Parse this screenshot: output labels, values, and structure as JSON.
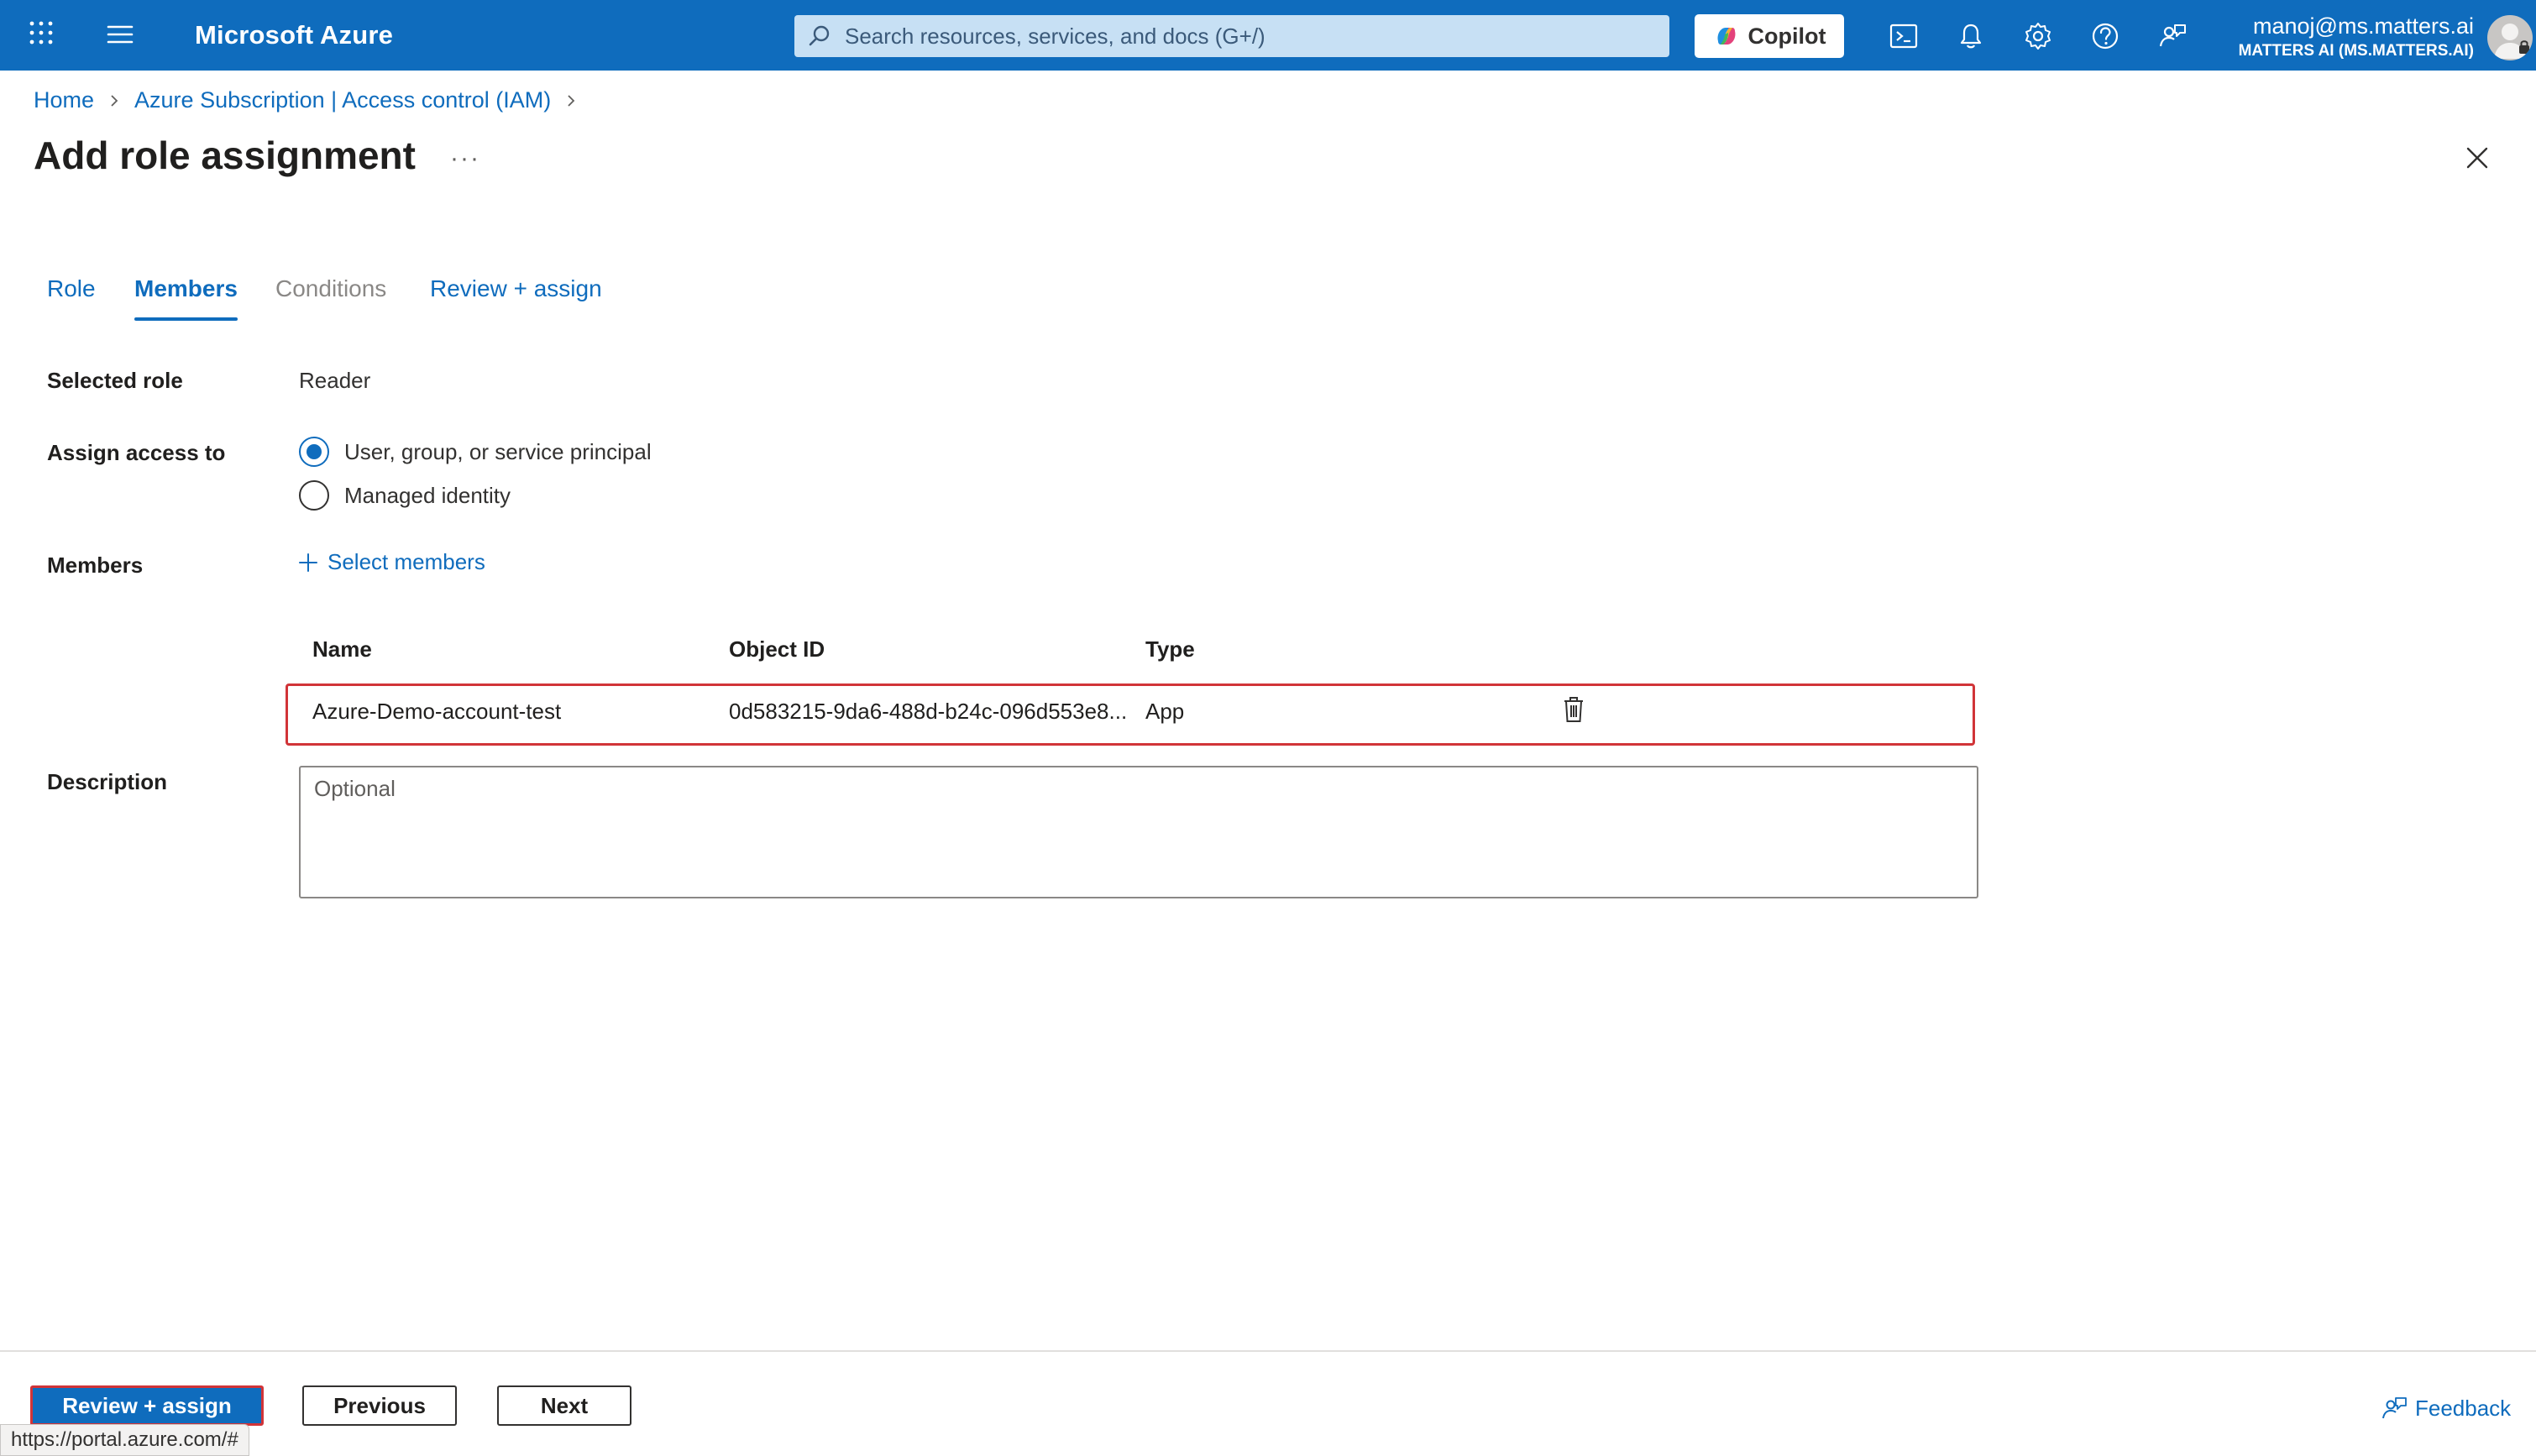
{
  "topbar": {
    "brand": "Microsoft Azure",
    "search_placeholder": "Search resources, services, and docs (G+/)",
    "copilot_label": "Copilot",
    "account_email": "manoj@ms.matters.ai",
    "account_tenant": "MATTERS AI (MS.MATTERS.AI)"
  },
  "breadcrumb": {
    "items": [
      "Home",
      "Azure Subscription | Access control (IAM)"
    ]
  },
  "page": {
    "title": "Add role assignment",
    "more": "···"
  },
  "tabs": [
    {
      "label": "Role",
      "state": "normal"
    },
    {
      "label": "Members",
      "state": "active"
    },
    {
      "label": "Conditions",
      "state": "disabled"
    },
    {
      "label": "Review + assign",
      "state": "normal"
    }
  ],
  "form": {
    "selected_role_label": "Selected role",
    "selected_role_value": "Reader",
    "assign_access_label": "Assign access to",
    "assign_options": [
      "User, group, or service principal",
      "Managed identity"
    ],
    "assign_selected": 0,
    "members_label": "Members",
    "select_members": "Select members",
    "description_label": "Description",
    "description_placeholder": "Optional"
  },
  "members_table": {
    "columns": [
      "Name",
      "Object ID",
      "Type"
    ],
    "rows": [
      {
        "name": "Azure-Demo-account-test",
        "object_id": "0d583215-9da6-488d-b24c-096d553e8...",
        "type": "App"
      }
    ]
  },
  "footer": {
    "review_assign": "Review + assign",
    "previous": "Previous",
    "next": "Next",
    "status_url": "https://portal.azure.com/#",
    "feedback": "Feedback"
  },
  "colors": {
    "azure_blue": "#0f6cbd",
    "search_bg": "#c7e0f4",
    "highlight_red": "#d13438"
  }
}
